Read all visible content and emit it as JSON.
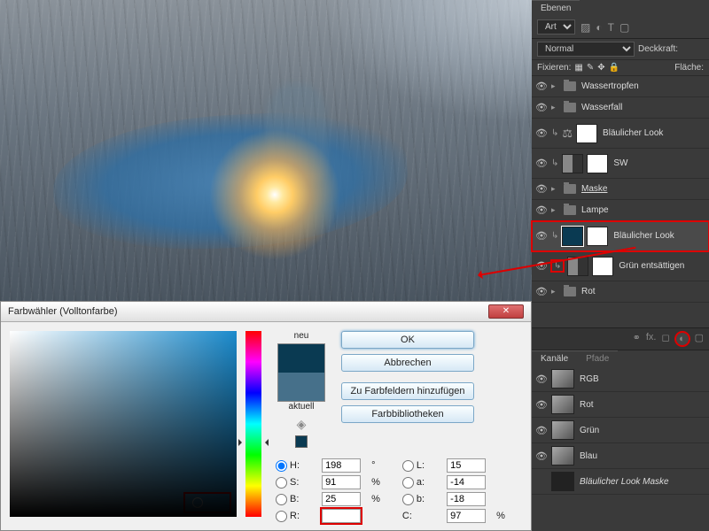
{
  "layers_panel": {
    "tab": "Ebenen",
    "kind_label": "Art",
    "blend_mode": "Normal",
    "opacity_label": "Deckkraft:",
    "lock_label": "Fixieren:",
    "fill_label": "Fläche:",
    "items": [
      {
        "name": "Wassertropfen",
        "type": "group"
      },
      {
        "name": "Wasserfall",
        "type": "group"
      },
      {
        "name": "Bläulicher Look",
        "type": "adjustment",
        "icon": "curves",
        "clip": true
      },
      {
        "name": "SW",
        "type": "adjustment",
        "icon": "bw",
        "clip": true
      },
      {
        "name": "Maske",
        "type": "group",
        "underline": true
      },
      {
        "name": "Lampe",
        "type": "group"
      },
      {
        "name": "Bläulicher Look",
        "type": "fill",
        "highlight": true,
        "clip": true
      },
      {
        "name": "Grün entsättigen",
        "type": "adjustment",
        "icon": "hue",
        "clip": true,
        "clip_highlight": true
      },
      {
        "name": "Rot",
        "type": "group"
      }
    ]
  },
  "channels_panel": {
    "tab1": "Kanäle",
    "tab2": "Pfade",
    "items": [
      "RGB",
      "Rot",
      "Grün",
      "Blau",
      "Bläulicher Look Maske"
    ]
  },
  "dialog": {
    "title": "Farbwähler (Volltonfarbe)",
    "new_label": "neu",
    "current_label": "aktuell",
    "buttons": {
      "ok": "OK",
      "cancel": "Abbrechen",
      "add": "Zu Farbfeldern hinzufügen",
      "libs": "Farbbibliotheken"
    },
    "values": {
      "H": "198",
      "H_unit": "°",
      "S": "91",
      "S_unit": "%",
      "B": "25",
      "B_unit": "%",
      "R": "",
      "L": "15",
      "a": "-14",
      "b": "-18",
      "C": "97",
      "C_unit": "%"
    },
    "labels": {
      "H": "H:",
      "S": "S:",
      "B": "B:",
      "R": "R:",
      "L": "L:",
      "a": "a:",
      "b": "b:",
      "C": "C:"
    }
  }
}
